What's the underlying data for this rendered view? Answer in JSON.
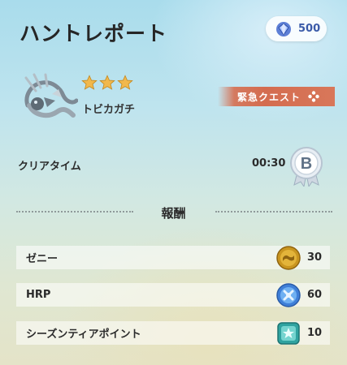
{
  "header": {
    "title": "ハントレポート"
  },
  "currency": {
    "icon": "gem-icon",
    "amount": "500"
  },
  "quest": {
    "monster_name": "トビカガチ",
    "stars": 3,
    "tag": "緊急クエスト"
  },
  "result": {
    "clear_time_label": "クリアタイム",
    "clear_time": "00:30",
    "rank": "B"
  },
  "rewards": {
    "title": "報酬",
    "items": [
      {
        "label": "ゼニー",
        "value": "30",
        "icon": "zenny-coin-icon"
      },
      {
        "label": "HRP",
        "value": "60",
        "icon": "hrp-icon"
      },
      {
        "label": "シーズンティアポイント",
        "value": "10",
        "icon": "season-tier-point-icon"
      }
    ]
  }
}
